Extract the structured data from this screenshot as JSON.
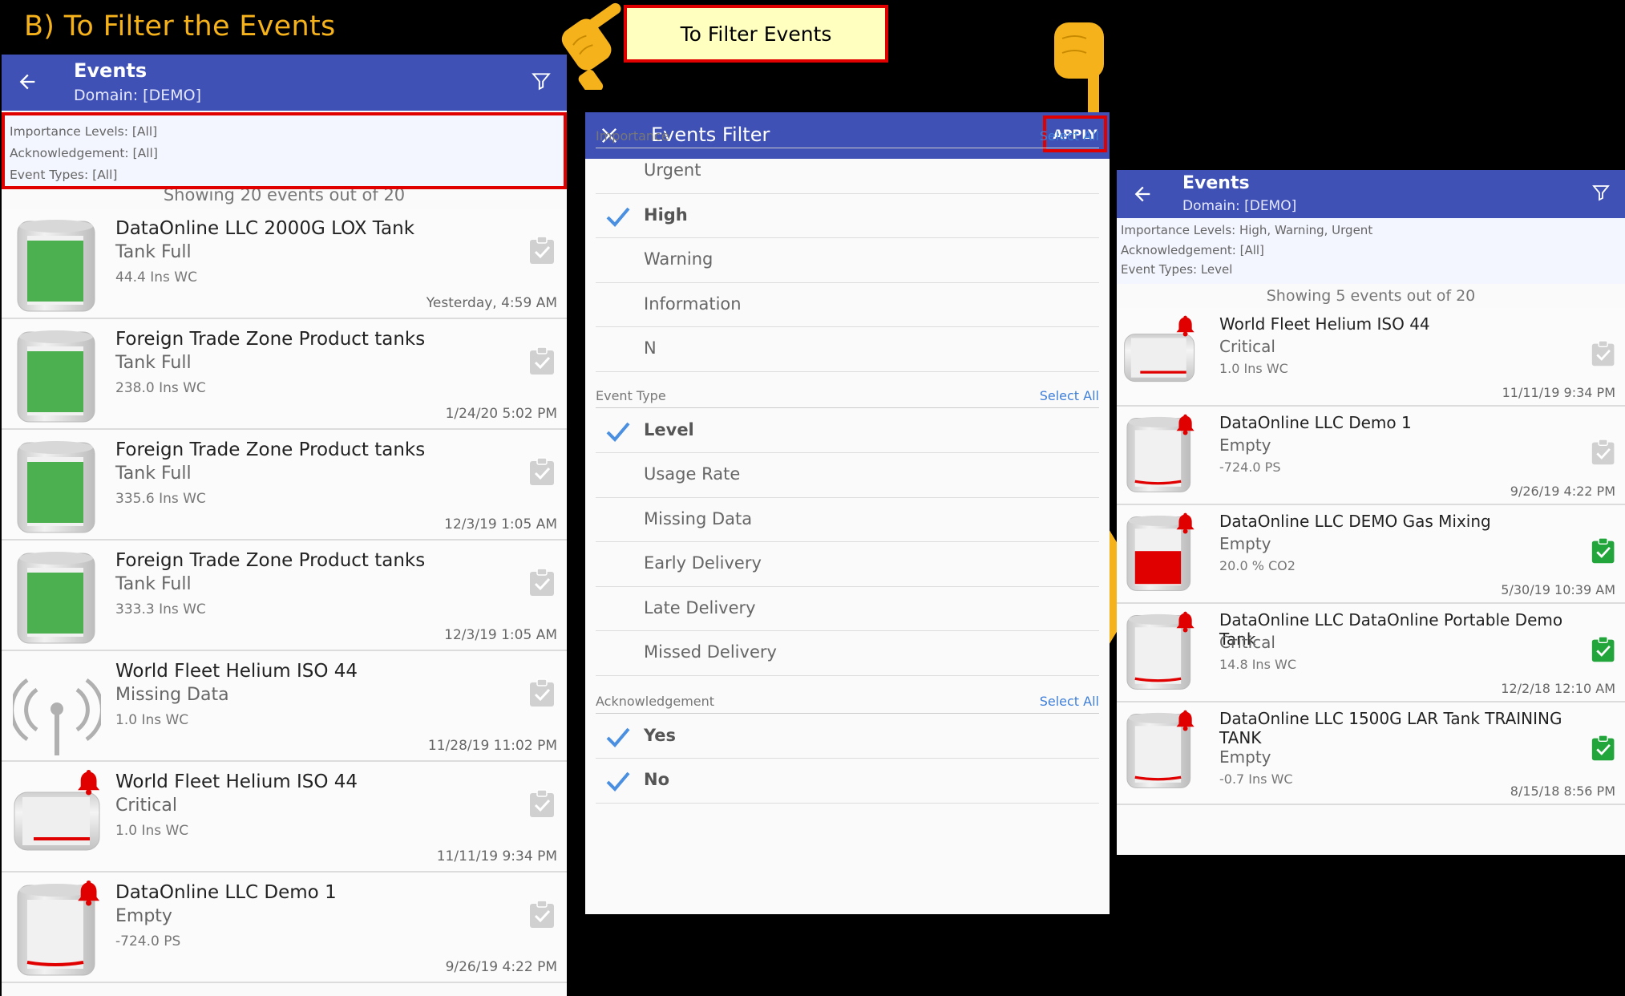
{
  "heading": "B) To Filter the Events",
  "callout": "To Filter Events",
  "colors": {
    "appbar": "#3f51b5",
    "accent": "#f5b21b",
    "red": "#e10000",
    "green": "#4caf50"
  },
  "left": {
    "title": "Events",
    "domain": "Domain: [DEMO]",
    "filter_lines": [
      "Importance Levels: [All]",
      "Acknowledgement: [All]",
      "Event Types: [All]"
    ],
    "showing": "Showing 20 events out of 20",
    "events": [
      {
        "name": "DataOnline LLC 2000G LOX Tank",
        "status": "Tank Full",
        "reading": "44.4 Ins WC",
        "time": "Yesterday, 4:59 AM",
        "icon": "green-tank-icon"
      },
      {
        "name": "Foreign Trade Zone Product tanks",
        "status": "Tank Full",
        "reading": "238.0 Ins WC",
        "time": "1/24/20 5:02 PM",
        "icon": "green-tank-icon"
      },
      {
        "name": "Foreign Trade Zone Product tanks",
        "status": "Tank Full",
        "reading": "335.6 Ins WC",
        "time": "12/3/19 1:05 AM",
        "icon": "green-tank-icon"
      },
      {
        "name": "Foreign Trade Zone Product tanks",
        "status": "Tank Full",
        "reading": "333.3 Ins WC",
        "time": "12/3/19 1:05 AM",
        "icon": "green-tank-icon"
      },
      {
        "name": "World Fleet Helium ISO 44",
        "status": "Missing Data",
        "reading": "1.0 Ins WC",
        "time": "11/28/19 11:02 PM",
        "icon": "antenna-icon"
      },
      {
        "name": "World Fleet Helium ISO 44",
        "status": "Critical",
        "reading": "1.0 Ins WC",
        "time": "11/11/19 9:34 PM",
        "icon": "horizontal-tank-alarm-icon"
      },
      {
        "name": "DataOnline LLC Demo 1",
        "status": "Empty",
        "reading": "-724.0 PS",
        "time": "9/26/19 4:22 PM",
        "icon": "empty-tank-alarm-icon"
      }
    ]
  },
  "filter": {
    "title": "Events Filter",
    "apply": "APPLY",
    "select_all": "Select All",
    "importance": {
      "label": "Importance",
      "options": [
        {
          "label": "Urgent",
          "checked": false
        },
        {
          "label": "High",
          "checked": true
        },
        {
          "label": "Warning",
          "checked": false
        },
        {
          "label": "Information",
          "checked": false
        },
        {
          "label": "N",
          "checked": false
        }
      ]
    },
    "event_type": {
      "label": "Event Type",
      "options": [
        {
          "label": "Level",
          "checked": true
        },
        {
          "label": "Usage Rate",
          "checked": false
        },
        {
          "label": "Missing Data",
          "checked": false
        },
        {
          "label": "Early Delivery",
          "checked": false
        },
        {
          "label": "Late Delivery",
          "checked": false
        },
        {
          "label": "Missed Delivery",
          "checked": false
        }
      ]
    },
    "acknowledgement": {
      "label": "Acknowledgement",
      "options": [
        {
          "label": "Yes",
          "checked": true
        },
        {
          "label": "No",
          "checked": true
        }
      ]
    }
  },
  "right": {
    "title": "Events",
    "domain": "Domain: [DEMO]",
    "filter_lines": [
      "Importance Levels: High, Warning, Urgent",
      "Acknowledgement: [All]",
      "Event Types: Level"
    ],
    "showing": "Showing 5 events out of 20",
    "events": [
      {
        "name": "World Fleet Helium ISO 44",
        "status": "Critical",
        "reading": "1.0 Ins WC",
        "time": "11/11/19 9:34 PM",
        "icon": "horizontal-tank-alarm-icon",
        "acked": false
      },
      {
        "name": "DataOnline LLC Demo 1",
        "status": "Empty",
        "reading": "-724.0 PS",
        "time": "9/26/19 4:22 PM",
        "icon": "empty-tank-alarm-icon",
        "acked": false
      },
      {
        "name": "DataOnline LLC DEMO Gas Mixing",
        "status": "Empty",
        "reading": "20.0 % CO2",
        "time": "5/30/19 10:39 AM",
        "icon": "red-tank-alarm-icon",
        "acked": true
      },
      {
        "name": "DataOnline LLC DataOnline Portable Demo Tank",
        "status": "Critical",
        "reading": "14.8 Ins WC",
        "time": "12/2/18 12:10 AM",
        "icon": "empty-tank-alarm-icon",
        "acked": true
      },
      {
        "name": "DataOnline LLC 1500G LAR Tank TRAINING TANK",
        "status": "Empty",
        "reading": "-0.7 Ins WC",
        "time": "8/15/18 8:56 PM",
        "icon": "empty-tank-alarm-icon",
        "acked": true
      }
    ]
  }
}
